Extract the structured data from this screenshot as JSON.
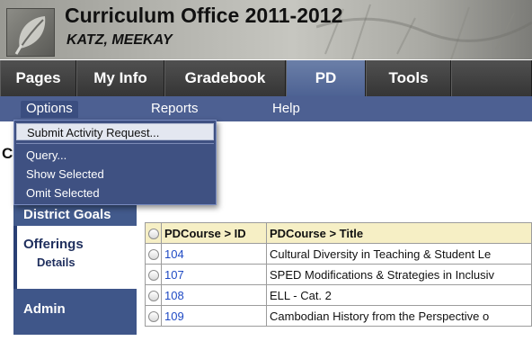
{
  "header": {
    "title": "Curriculum Office 2011-2012",
    "user": "KATZ, MEEKAY"
  },
  "tabs": [
    {
      "label": "Pages",
      "active": false
    },
    {
      "label": "My Info",
      "active": false
    },
    {
      "label": "Gradebook",
      "active": false
    },
    {
      "label": "PD",
      "active": true
    },
    {
      "label": "Tools",
      "active": false
    }
  ],
  "subnav": {
    "options": "Options",
    "reports": "Reports",
    "help": "Help"
  },
  "options_menu": {
    "items": [
      "Submit Activity Request...",
      "Query...",
      "Show Selected",
      "Omit Selected"
    ]
  },
  "page": {
    "heading_letter": "C"
  },
  "leftnav": {
    "district_goals": "District Goals",
    "offerings": "Offerings",
    "details": "Details",
    "admin": "Admin"
  },
  "table": {
    "headers": [
      "PDCourse > ID",
      "PDCourse > Title"
    ],
    "rows": [
      {
        "id": "104",
        "title": "Cultural Diversity in Teaching & Student Le"
      },
      {
        "id": "107",
        "title": "SPED Modifications & Strategies in Inclusiv"
      },
      {
        "id": "108",
        "title": "ELL - Cat. 2"
      },
      {
        "id": "109",
        "title": "Cambodian History from the Perspective o"
      }
    ]
  },
  "colors": {
    "nav_blue": "#4d6092",
    "tab_active": "#5a6fa0",
    "header_cell": "#f6efc5",
    "link": "#1f4ac4"
  }
}
